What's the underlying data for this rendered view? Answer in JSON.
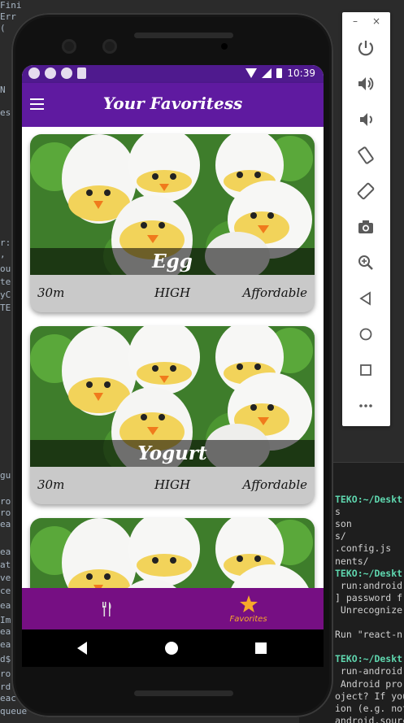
{
  "app": {
    "title": "Your Favoritess",
    "status_time": "10:39"
  },
  "meals": [
    {
      "title": "Egg",
      "duration": "30m",
      "complexity": "HIGH",
      "affordability": "Affordable"
    },
    {
      "title": "Yogurt",
      "duration": "30m",
      "complexity": "HIGH",
      "affordability": "Affordable"
    },
    {
      "title": "",
      "duration": "",
      "complexity": "",
      "affordability": ""
    }
  ],
  "tabs": {
    "meals_label": "",
    "favorites_label": "Favorites",
    "active": "favorites"
  },
  "colors": {
    "appbar": "#5f1aa0",
    "statusbar": "#4f1a8e",
    "tabbar": "#760f83",
    "active_tab": "#f7a82a"
  },
  "emulator": {
    "minimize": "–",
    "close": "×",
    "buttons": [
      "power-icon",
      "volume-up-icon",
      "volume-down-icon",
      "rotate-left-icon",
      "rotate-right-icon",
      "camera-icon",
      "zoom-icon",
      "back-icon",
      "home-icon",
      "overview-icon",
      "more-icon"
    ]
  },
  "terminal": {
    "lines": [
      {
        "text": "TEKO:~/Deskt",
        "prompt": true
      },
      {
        "text": "s",
        "prompt": false
      },
      {
        "text": "son",
        "prompt": false
      },
      {
        "text": "s/",
        "prompt": false
      },
      {
        "text": ".config.js",
        "prompt": false
      },
      {
        "text": "nents/",
        "prompt": false
      },
      {
        "text": "TEKO:~/Deskt",
        "prompt": true
      },
      {
        "text": " run:android",
        "prompt": false
      },
      {
        "text": "] password f",
        "prompt": false
      },
      {
        "text": " Unrecognize",
        "prompt": false
      },
      {
        "text": "",
        "prompt": false
      },
      {
        "text": "Run \"react-n",
        "prompt": false
      },
      {
        "text": "",
        "prompt": false
      },
      {
        "text": "TEKO:~/Deskt",
        "prompt": true
      },
      {
        "text": " run-android",
        "prompt": false
      },
      {
        "text": " Android pro",
        "prompt": false
      },
      {
        "text": "oject? If you",
        "prompt": false
      },
      {
        "text": "ion (e.g. not in",
        "prompt": false
      },
      {
        "text": "android.sourceDi",
        "prompt": false
      }
    ]
  },
  "ide_fragments": [
    {
      "text": "Fini"
    },
    {
      "text": "Err"
    },
    {
      "text": "("
    },
    {
      "text": "N"
    },
    {
      "text": "es"
    },
    {
      "text": "r:"
    },
    {
      "text": ","
    },
    {
      "text": "ou"
    },
    {
      "text": "te"
    },
    {
      "text": "yC"
    },
    {
      "text": "TE"
    },
    {
      "text": "gu"
    },
    {
      "text": "ro"
    },
    {
      "text": "ro"
    },
    {
      "text": "ea"
    },
    {
      "text": "ea"
    },
    {
      "text": "at"
    },
    {
      "text": "ve"
    },
    {
      "text": "ce"
    },
    {
      "text": "ea"
    },
    {
      "text": "Im"
    },
    {
      "text": "ea"
    },
    {
      "text": "ea"
    },
    {
      "text": "d$"
    },
    {
      "text": "ro"
    },
    {
      "text": "rd"
    },
    {
      "text": "eact-n"
    },
    {
      "text": "queue"
    }
  ]
}
